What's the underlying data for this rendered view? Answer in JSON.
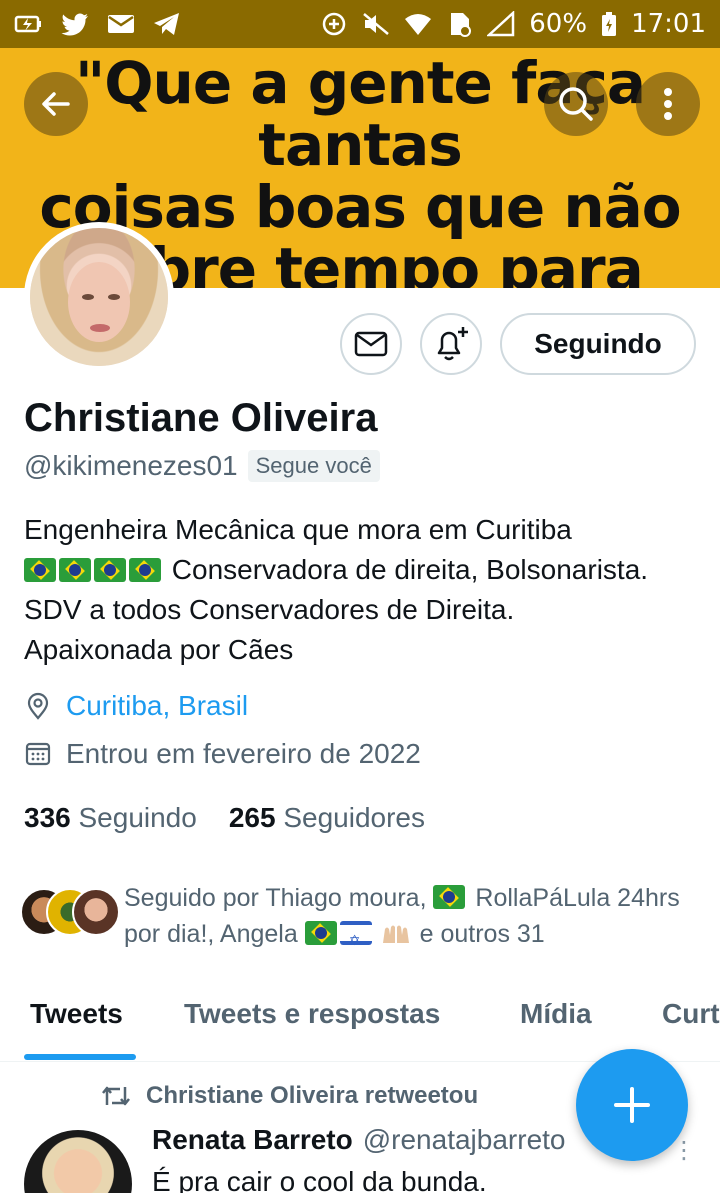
{
  "status_bar": {
    "battery": "60%",
    "time": "17:01"
  },
  "banner": {
    "quote": "\"Que a gente faça tantas\ncoisas boas que não\nsobre tempo para\npensamentos ruins.\""
  },
  "actions": {
    "follow_label": "Seguindo"
  },
  "profile": {
    "name": "Christiane Oliveira",
    "handle": "@kikimenezes01",
    "follows_you": "Segue você",
    "bio_line1": "Engenheira Mecânica que mora em Curitiba",
    "bio_line2": "Conservadora de direita, Bolsonarista.",
    "bio_line3": "SDV a todos Conservadores de Direita.",
    "bio_line4": "Apaixonada por Cães",
    "location": "Curitiba, Brasil",
    "joined": "Entrou em fevereiro de 2022",
    "following_count": "336",
    "following_label": "Seguindo",
    "followers_count": "265",
    "followers_label": "Seguidores",
    "followed_by_1": "Seguido por Thiago moura,",
    "followed_by_2": "RollaPáLula 24hrs",
    "followed_by_3": "por dia!, Angela",
    "followed_by_4": "e outros 31"
  },
  "tabs": [
    {
      "label": "Tweets"
    },
    {
      "label": "Tweets e respostas"
    },
    {
      "label": "Mídia"
    },
    {
      "label": "Curtidas"
    }
  ],
  "tweet": {
    "retweet_label": "Christiane Oliveira retweetou",
    "author": "Renata Barreto",
    "handle": "@renatajbarreto",
    "text": "É pra cair o cool da bunda."
  },
  "colors": {
    "accent": "#1d9bf0",
    "status_bar": "#8a6a00",
    "banner": "#f2b419"
  }
}
